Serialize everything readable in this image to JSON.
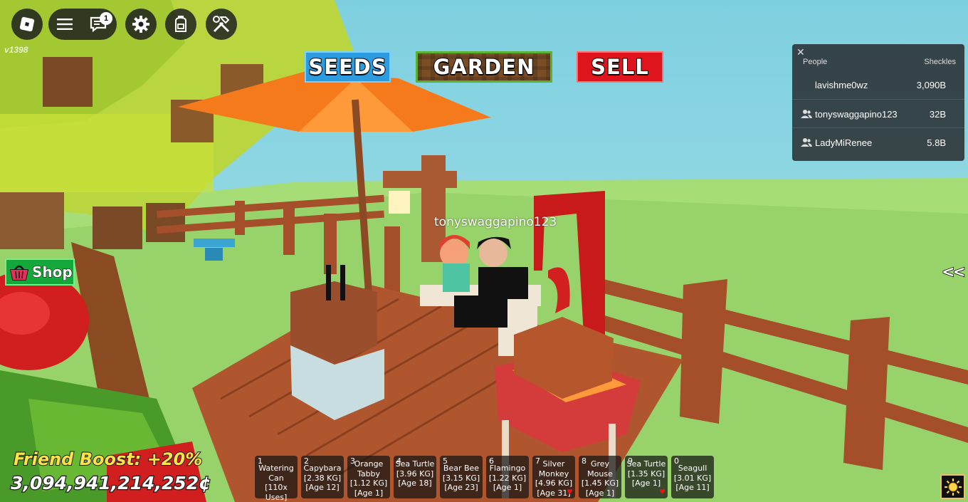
{
  "topbar": {
    "notification_count": "1",
    "version": "v1398"
  },
  "nav": {
    "seeds": "SEEDS",
    "garden": "GARDEN",
    "sell": "SELL"
  },
  "leaderboard": {
    "close": "✕",
    "col_people": "People",
    "col_currency": "Sheckles",
    "rows": [
      {
        "name": "lavishme0wz",
        "value": "3,090B"
      },
      {
        "name": "tonyswaggapino123",
        "value": "32B"
      },
      {
        "name": "LadyMiRenee",
        "value": "5.8B"
      }
    ]
  },
  "player_nametag": "tonyswaggapino123",
  "shop_label": "Shop",
  "collapse_label": "<<",
  "friend_boost": "Friend Boost: +20%",
  "money": "3,094,941,214,252¢",
  "hotbar": [
    {
      "num": "1",
      "text": "Watering Can [110x Uses]"
    },
    {
      "num": "2",
      "text": "Capybara [2.38 KG] [Age 12]"
    },
    {
      "num": "3",
      "text": "Orange Tabby [1.12 KG] [Age 1]"
    },
    {
      "num": "4",
      "text": "Sea Turtle [3.96 KG] [Age 18]"
    },
    {
      "num": "5",
      "text": "Bear Bee [3.15 KG] [Age 23]"
    },
    {
      "num": "6",
      "text": "Flamingo [1.22 KG] [Age 1]"
    },
    {
      "num": "7",
      "text": "Silver Monkey [4.96 KG] [Age 31]"
    },
    {
      "num": "8",
      "text": "Grey Mouse [1.45 KG] [Age 1]"
    },
    {
      "num": "9",
      "text": "Sea Turtle [1.35 KG] [Age 1]"
    },
    {
      "num": "0",
      "text": "Seagull [3.01 KG] [Age 11]"
    }
  ],
  "colors": {
    "seeds": "#2d9be0",
    "garden": "#7a4d25",
    "sell": "#e0141c",
    "shop": "#14a83a",
    "boost": "#ffe24a"
  }
}
